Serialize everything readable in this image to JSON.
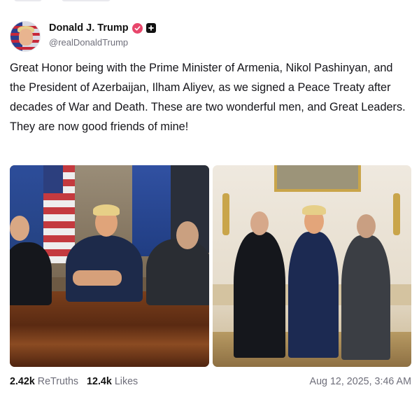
{
  "post": {
    "display_name": "Donald J. Trump",
    "handle": "@realDonaldTrump",
    "verified_icon": "verified-badge-icon",
    "plus_icon": "plus-badge-icon",
    "text": "Great Honor being with the Prime Minister of Armenia, Nikol Pashinyan, and the President of Azerbaijan, Ilham Aliyev, as we signed a Peace Treaty after decades of War and Death. These are two wonderful men, and Great Leaders. They are now good friends of mine!",
    "media": [
      {
        "kind": "photo",
        "subject": "handshake"
      },
      {
        "kind": "photo",
        "subject": "three-men-standing"
      }
    ],
    "stats": {
      "retruths_count": "2.42k",
      "retruths_label": "ReTruths",
      "likes_count": "12.4k",
      "likes_label": "Likes"
    },
    "timestamp": "Aug 12, 2025, 3:46 AM"
  },
  "colors": {
    "verified_badge": "#e8466b",
    "muted_text": "#6e6e7a",
    "body_text": "#15151a"
  }
}
